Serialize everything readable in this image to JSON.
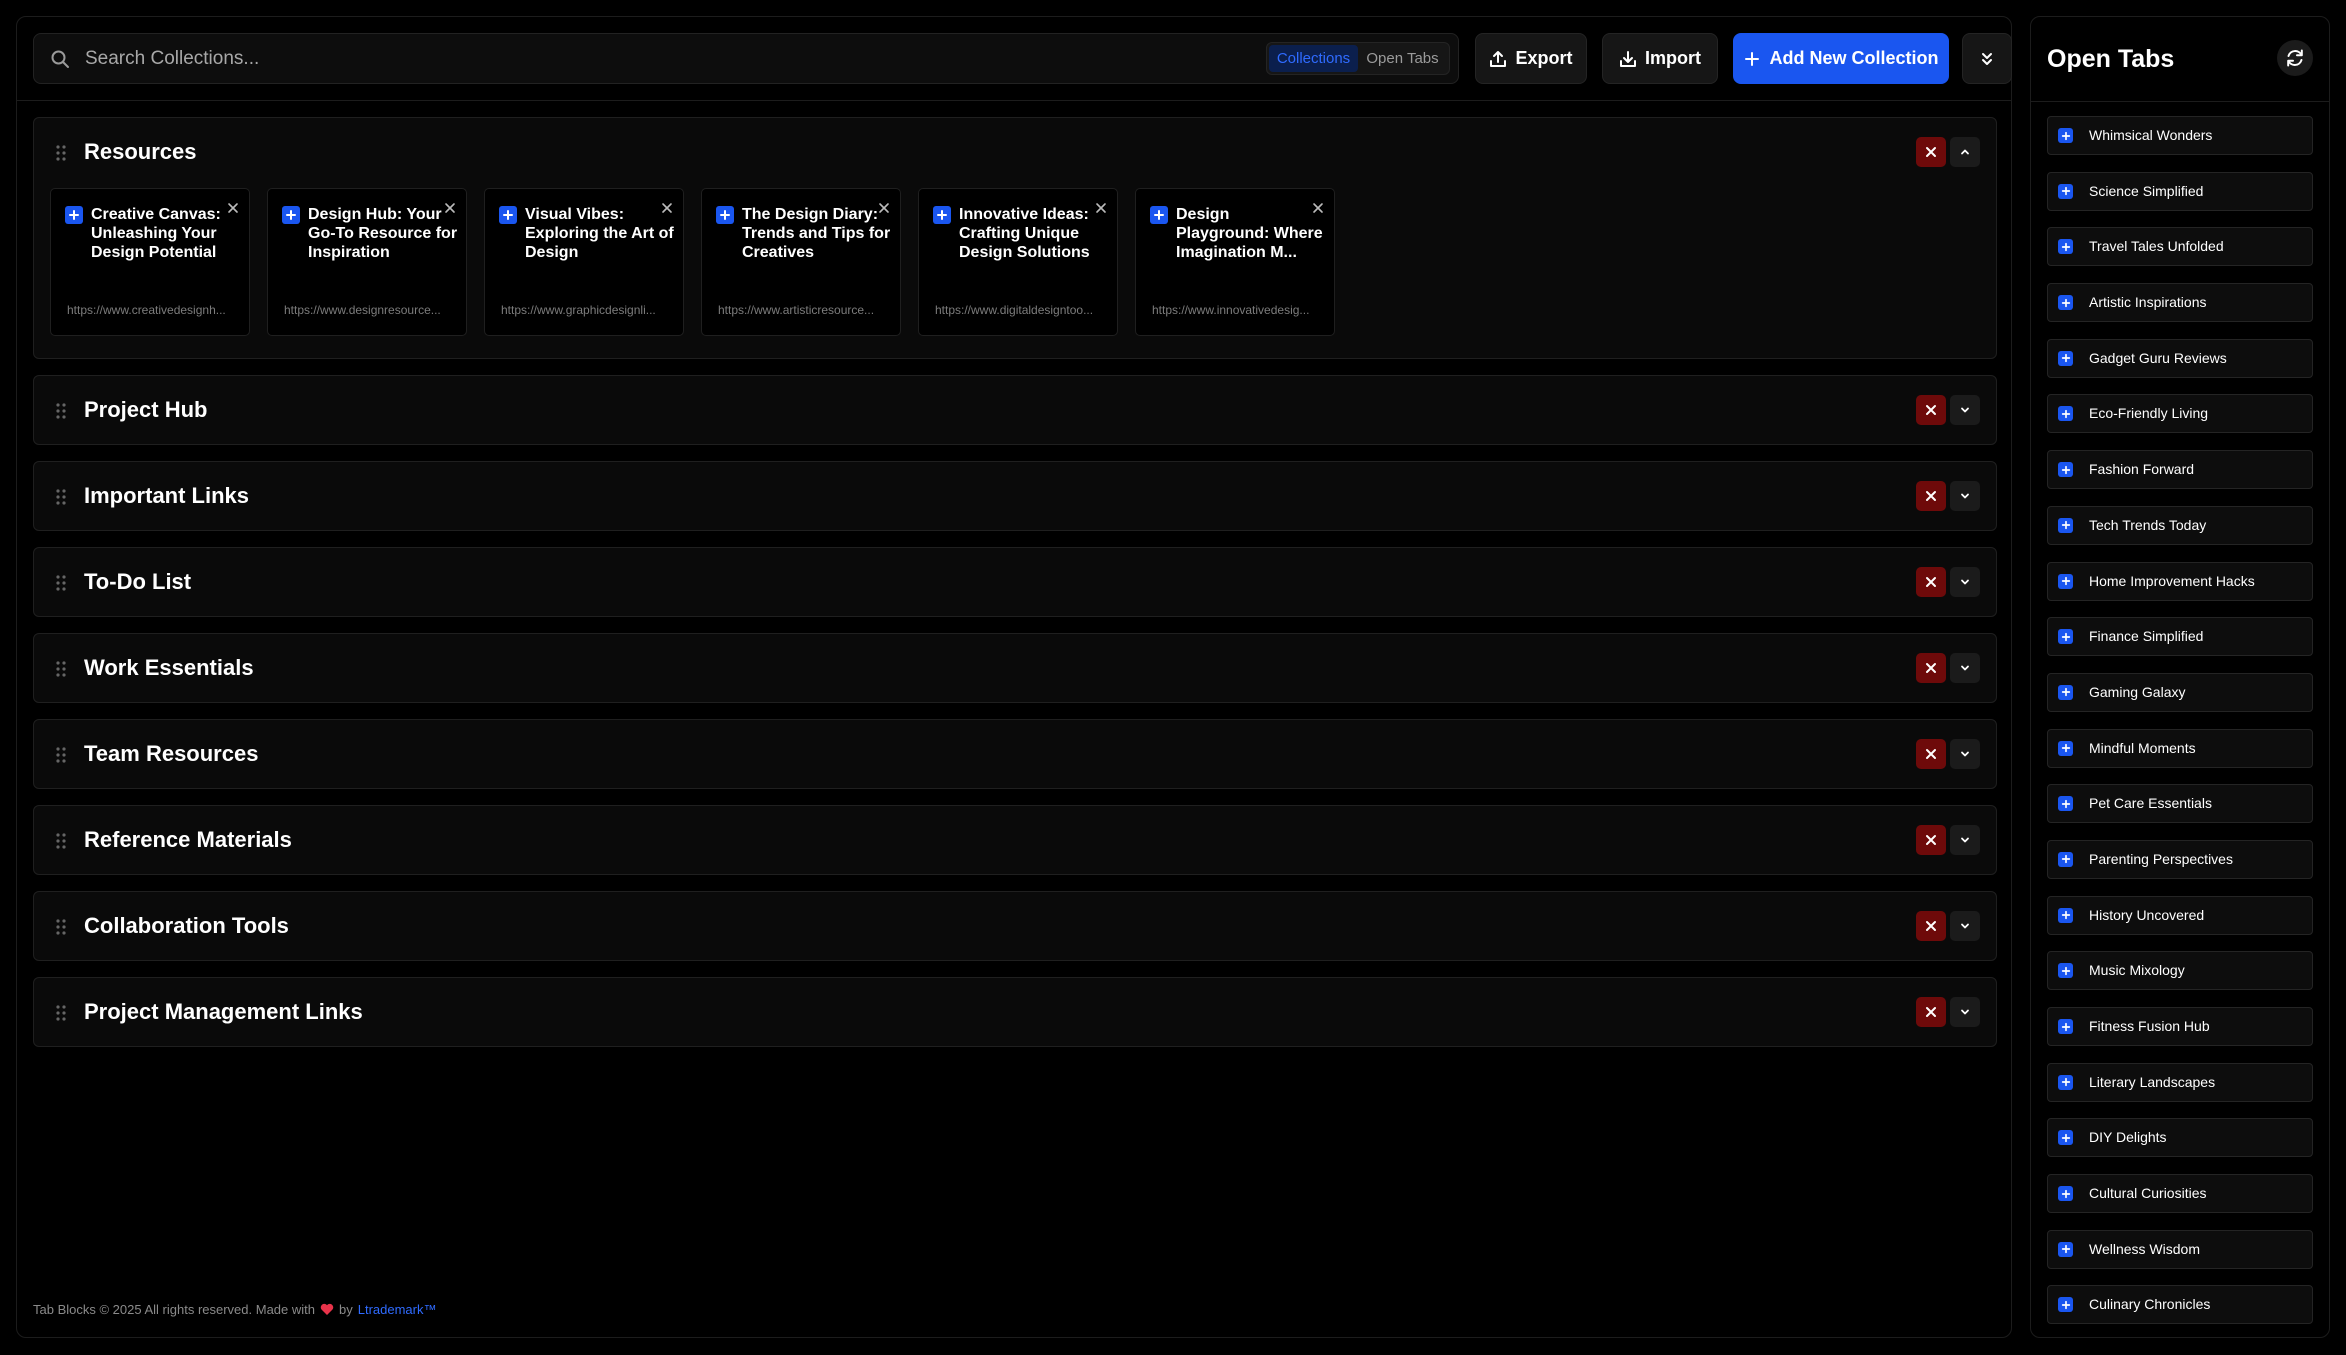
{
  "search": {
    "placeholder": "Search Collections..."
  },
  "view_toggle": {
    "options": [
      "Collections",
      "Open Tabs"
    ],
    "active": "Collections"
  },
  "toolbar": {
    "export_label": "Export",
    "import_label": "Import",
    "add_label": "Add New Collection"
  },
  "colors": {
    "accent": "#1a56f0",
    "delete": "#6e0a0a",
    "background": "#000000",
    "panel": "#0a0a0a"
  },
  "collections": [
    {
      "title": "Resources",
      "expanded": true,
      "cards": [
        {
          "title": "Creative Canvas: Unleashing Your Design Potential",
          "url": "https://www.creativedesignh..."
        },
        {
          "title": "Design Hub: Your Go-To Resource for Inspiration",
          "url": "https://www.designresource..."
        },
        {
          "title": "Visual Vibes: Exploring the Art of Design",
          "url": "https://www.graphicdesignli..."
        },
        {
          "title": "The Design Diary: Trends and Tips for Creatives",
          "url": "https://www.artisticresource..."
        },
        {
          "title": "Innovative Ideas: Crafting Unique Design Solutions",
          "url": "https://www.digitaldesigntoo..."
        },
        {
          "title": "Design Playground: Where Imagination M...",
          "url": "https://www.innovativedesig..."
        }
      ]
    },
    {
      "title": "Project Hub",
      "expanded": false,
      "cards": []
    },
    {
      "title": "Important Links",
      "expanded": false,
      "cards": []
    },
    {
      "title": "To-Do List",
      "expanded": false,
      "cards": []
    },
    {
      "title": "Work Essentials",
      "expanded": false,
      "cards": []
    },
    {
      "title": "Team Resources",
      "expanded": false,
      "cards": []
    },
    {
      "title": "Reference Materials",
      "expanded": false,
      "cards": []
    },
    {
      "title": "Collaboration Tools",
      "expanded": false,
      "cards": []
    },
    {
      "title": "Project Management Links",
      "expanded": false,
      "cards": []
    }
  ],
  "footer": {
    "text": "Tab Blocks © 2025 All rights reserved. Made with",
    "by": "by",
    "author": "Ltrademark™"
  },
  "sidebar": {
    "title": "Open Tabs",
    "tabs": [
      "Whimsical Wonders",
      "Science Simplified",
      "Travel Tales Unfolded",
      "Artistic Inspirations",
      "Gadget Guru Reviews",
      "Eco-Friendly Living",
      "Fashion Forward",
      "Tech Trends Today",
      "Home Improvement Hacks",
      "Finance Simplified",
      "Gaming Galaxy",
      "Mindful Moments",
      "Pet Care Essentials",
      "Parenting Perspectives",
      "History Uncovered",
      "Music Mixology",
      "Fitness Fusion Hub",
      "Literary Landscapes",
      "DIY Delights",
      "Cultural Curiosities",
      "Wellness Wisdom",
      "Culinary Chronicles"
    ]
  }
}
